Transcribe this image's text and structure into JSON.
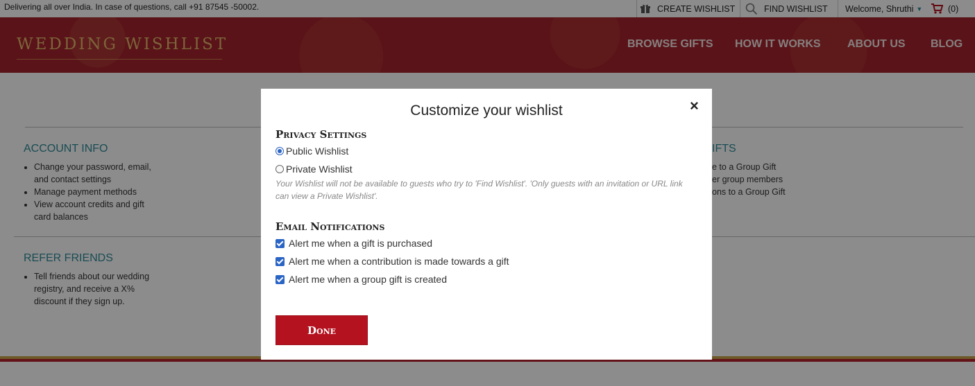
{
  "topbar": {
    "delivery_text": "Delivering all over India. In case of questions, call +91 87545 -50002.",
    "create_wishlist": "CREATE WISHLIST",
    "find_wishlist": "FIND WISHLIST",
    "welcome": "Welcome, Shruthi",
    "cart_count": "(0)"
  },
  "header": {
    "logo": "WEDDING WISHLIST",
    "nav": [
      "BROWSE GIFTS",
      "HOW IT WORKS",
      "ABOUT US",
      "BLOG"
    ]
  },
  "page": {
    "account_info": {
      "title": "ACCOUNT INFO",
      "items": [
        "Change your password, email, and contact settings",
        "Manage payment methods",
        "View account credits and gift card balances"
      ]
    },
    "refer_friends": {
      "title": "REFER FRIENDS",
      "items": [
        "Tell friends about our wedding registry, and receive a X% discount if they sign up."
      ]
    },
    "group_gifts": {
      "title": "IFTS",
      "items": [
        "e to a Group Gift",
        "er group members",
        "ons to a Group Gift"
      ]
    }
  },
  "modal": {
    "title": "Customize your wishlist",
    "close": "×",
    "privacy_heading": "Privacy Settings",
    "public_label": "Public Wishlist",
    "private_label": "Private Wishlist",
    "privacy_selected": "public",
    "private_note": "Your Wishlist will not be available to guests who try to 'Find Wishlist'. 'Only guests with an invitation or URL link can view a Private Wishlist'.",
    "email_heading": "Email Notifications",
    "notifications": [
      {
        "label": "Alert me when a gift is purchased",
        "checked": true
      },
      {
        "label": "Alert me when a contribution is made towards a gift",
        "checked": true
      },
      {
        "label": "Alert me when a group gift is created",
        "checked": true
      }
    ],
    "done_label": "Done"
  },
  "colors": {
    "brand_red": "#a5232c",
    "button_red": "#b5121f",
    "teal": "#2e8b9a",
    "gold": "#e2b86a"
  }
}
